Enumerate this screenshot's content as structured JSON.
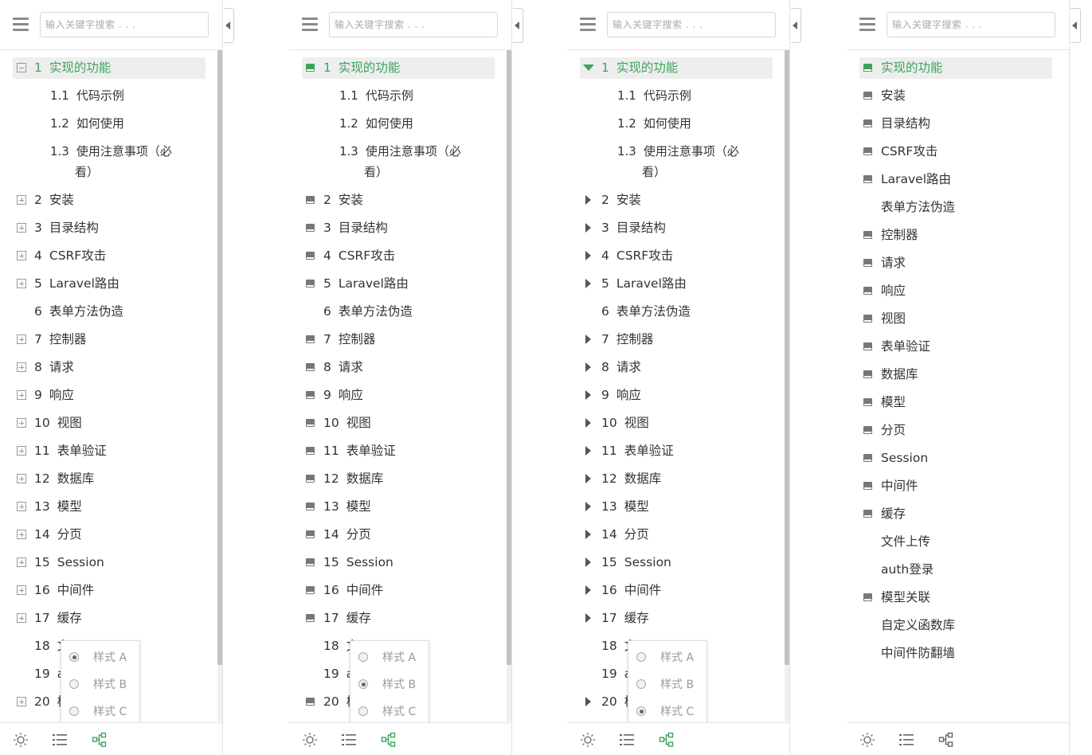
{
  "search": {
    "placeholder": "输入关键字搜索 . . ."
  },
  "toc": {
    "items": [
      {
        "num": "1",
        "label": "实现的功能"
      },
      {
        "num": "1.1",
        "label": "代码示例"
      },
      {
        "num": "1.2",
        "label": "如何使用"
      },
      {
        "num": "1.3",
        "label": "使用注意事项（必",
        "label_line2": "看）"
      },
      {
        "num": "2",
        "label": "安装"
      },
      {
        "num": "3",
        "label": "目录结构"
      },
      {
        "num": "4",
        "label": "CSRF攻击"
      },
      {
        "num": "5",
        "label": "Laravel路由"
      },
      {
        "num": "6",
        "label": "表单方法伪造"
      },
      {
        "num": "7",
        "label": "控制器"
      },
      {
        "num": "8",
        "label": "请求"
      },
      {
        "num": "9",
        "label": "响应"
      },
      {
        "num": "10",
        "label": "视图"
      },
      {
        "num": "11",
        "label": "表单验证"
      },
      {
        "num": "12",
        "label": "数据库"
      },
      {
        "num": "13",
        "label": "模型"
      },
      {
        "num": "14",
        "label": "分页"
      },
      {
        "num": "15",
        "label": "Session"
      },
      {
        "num": "16",
        "label": "中间件"
      },
      {
        "num": "17",
        "label": "缓存"
      },
      {
        "num": "18",
        "label": "文"
      },
      {
        "num": "19",
        "label": "a"
      },
      {
        "num": "20",
        "label": "模"
      }
    ]
  },
  "flat_list": {
    "items": [
      {
        "label": "实现的功能",
        "icon": "book-icon"
      },
      {
        "label": "安装",
        "icon": "book-icon"
      },
      {
        "label": "目录结构",
        "icon": "book-icon"
      },
      {
        "label": "CSRF攻击",
        "icon": "book-icon"
      },
      {
        "label": "Laravel路由",
        "icon": "book-icon"
      },
      {
        "label": "表单方法伪造",
        "icon": ""
      },
      {
        "label": "控制器",
        "icon": "book-icon"
      },
      {
        "label": "请求",
        "icon": "book-icon"
      },
      {
        "label": "响应",
        "icon": "book-icon"
      },
      {
        "label": "视图",
        "icon": "book-icon"
      },
      {
        "label": "表单验证",
        "icon": "book-icon"
      },
      {
        "label": "数据库",
        "icon": "book-icon"
      },
      {
        "label": "模型",
        "icon": "book-icon"
      },
      {
        "label": "分页",
        "icon": "book-icon"
      },
      {
        "label": "Session",
        "icon": "book-icon"
      },
      {
        "label": "中间件",
        "icon": "book-icon"
      },
      {
        "label": "缓存",
        "icon": "book-icon"
      },
      {
        "label": "文件上传",
        "icon": ""
      },
      {
        "label": "auth登录",
        "icon": ""
      },
      {
        "label": "模型关联",
        "icon": "book-icon"
      },
      {
        "label": "自定义函数库",
        "icon": ""
      },
      {
        "label": "中间件防翻墙",
        "icon": ""
      }
    ]
  },
  "style_menu": {
    "options": [
      "样式 A",
      "样式 B",
      "样式 C"
    ]
  },
  "panels": [
    {
      "style": "A",
      "selected_option": 0,
      "expander": "plus-minus"
    },
    {
      "style": "B",
      "selected_option": 1,
      "expander": "book"
    },
    {
      "style": "C",
      "selected_option": 2,
      "expander": "triangle"
    },
    {
      "style": "flat",
      "selected_option": null,
      "expander": "book"
    }
  ],
  "footer": {
    "icons": [
      "sun-icon",
      "list-icon",
      "tree-icon"
    ]
  },
  "colors": {
    "accent": "#3aa55b",
    "selected_bg": "#eeeeee",
    "text": "#333333",
    "muted": "#999999"
  }
}
